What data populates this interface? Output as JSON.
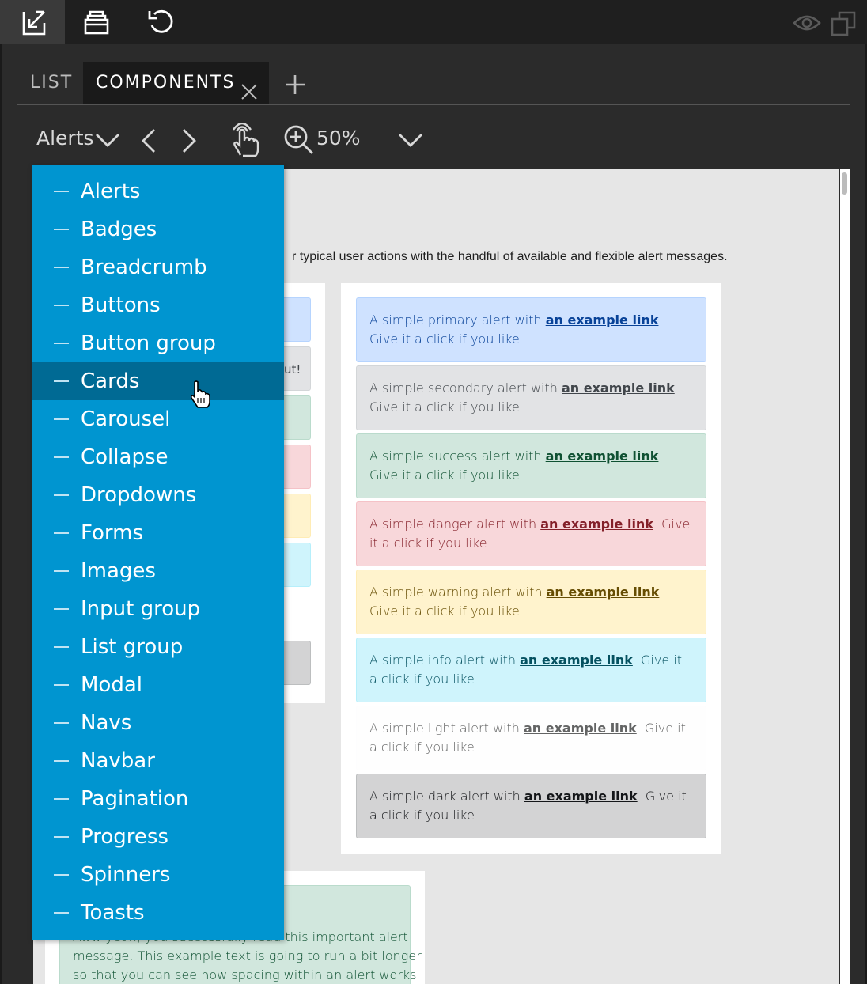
{
  "toolbar": {
    "icons": [
      "import-icon",
      "archive-icon",
      "undo-icon",
      "eye-icon",
      "duplicate-windows-icon"
    ]
  },
  "tabs": [
    {
      "label": "LIST"
    },
    {
      "label": "COMPONENTS"
    }
  ],
  "secondary_toolbar": {
    "category": "Alerts",
    "zoom": "50%"
  },
  "canvas": {
    "intro_text": "r typical user actions with the handful of available and flexible alert messages.",
    "partial_text": "ut!",
    "alerts": [
      {
        "prefix": "A simple primary alert with ",
        "link": "an example link",
        "suffix": ". Give it a click if you like.",
        "bg": "#cfe2ff",
        "border": "#b6d4fe",
        "color": "#084298"
      },
      {
        "prefix": "A simple secondary alert with ",
        "link": "an example link",
        "suffix": ". Give it a click if you like.",
        "bg": "#e2e3e5",
        "border": "#d3d6d8",
        "color": "#41464b"
      },
      {
        "prefix": "A simple success alert with ",
        "link": "an example link",
        "suffix": ". Give it a click if you like.",
        "bg": "#d1e7dd",
        "border": "#badbcc",
        "color": "#0f5132"
      },
      {
        "prefix": "A simple danger alert with ",
        "link": "an example link",
        "suffix": ". Give it a click if you like.",
        "bg": "#f8d7da",
        "border": "#f5c2c7",
        "color": "#842029"
      },
      {
        "prefix": "A simple warning alert with ",
        "link": "an example link",
        "suffix": ". Give it a click if you like.",
        "bg": "#fff3cd",
        "border": "#ffecb5",
        "color": "#664d03"
      },
      {
        "prefix": "A simple info alert with ",
        "link": "an example link",
        "suffix": ". Give it a click if you like.",
        "bg": "#cff4fc",
        "border": "#b6effb",
        "color": "#055160"
      },
      {
        "prefix": "A simple light alert with ",
        "link": "an example link",
        "suffix": ". Give it a click if you like.",
        "bg": "#fefefe",
        "border": "#fdfdfe",
        "color": "#636464"
      },
      {
        "prefix": "A simple dark alert with ",
        "link": "an example link",
        "suffix": ". Give it a click if you like.",
        "bg": "#d3d3d4",
        "border": "#bcbebf",
        "color": "#141619"
      }
    ],
    "bottom_alert": {
      "line1": "Aww yeah, you successfully read this important alert",
      "line2": "message. This example text is going to run a bit longer",
      "line3": "so that you can see how spacing within an alert works"
    }
  },
  "dropdown": {
    "items": [
      "Alerts",
      "Badges",
      "Breadcrumb",
      "Buttons",
      "Button group",
      "Cards",
      "Carousel",
      "Collapse",
      "Dropdowns",
      "Forms",
      "Images",
      "Input group",
      "List group",
      "Modal",
      "Navs",
      "Navbar",
      "Pagination",
      "Progress",
      "Spinners",
      "Toasts"
    ],
    "hovered": "Cards"
  }
}
